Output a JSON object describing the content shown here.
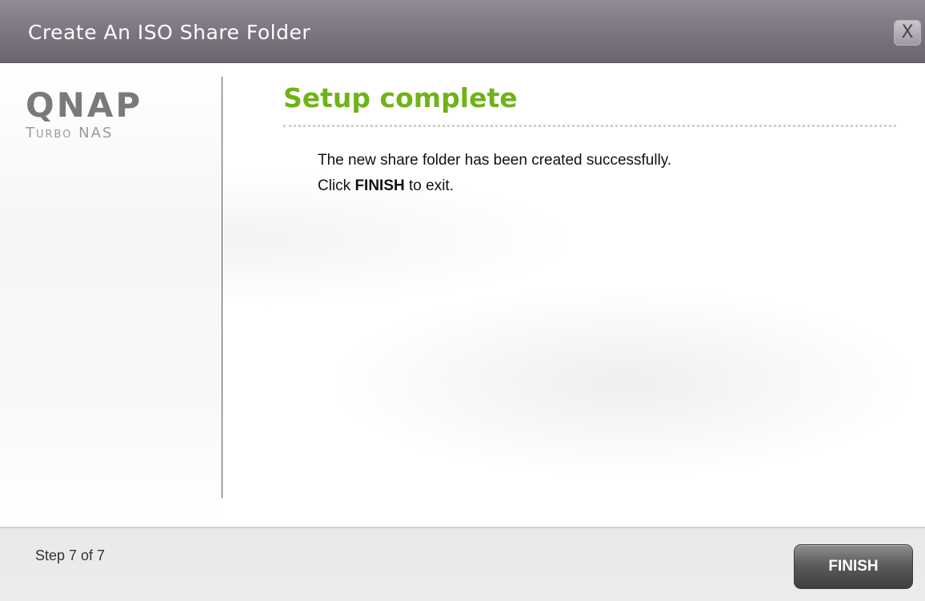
{
  "window": {
    "title": "Create An ISO Share Folder",
    "close_label": "X"
  },
  "sidebar": {
    "logo_main": "QNAP",
    "logo_sub": "Turbo NAS"
  },
  "main": {
    "heading": "Setup complete",
    "message_line1": "The new share folder has been created successfully.",
    "message_line2_prefix": "Click ",
    "message_line2_bold": "FINISH",
    "message_line2_suffix": " to exit."
  },
  "footer": {
    "step_text": "Step 7 of 7",
    "finish_label": "FINISH"
  },
  "colors": {
    "heading_green": "#6fb318",
    "titlebar": "#7a747e"
  },
  "icons": {
    "close": "close-icon"
  }
}
